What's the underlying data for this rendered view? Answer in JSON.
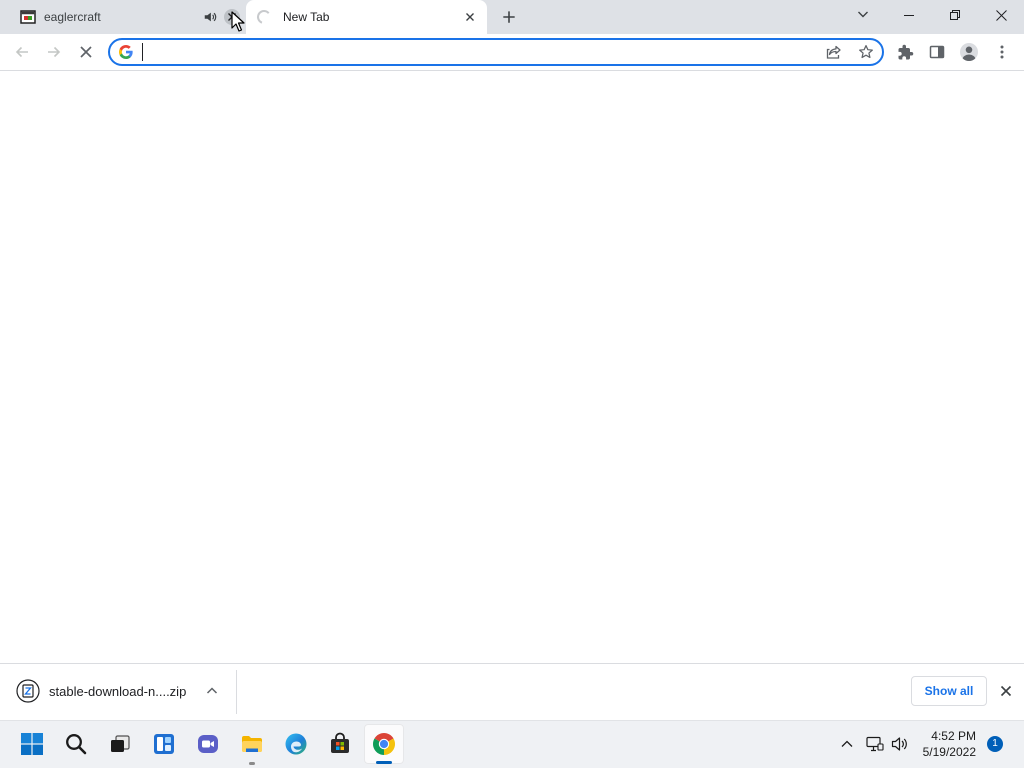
{
  "window": {
    "tabs": [
      {
        "title": "eaglercraft",
        "favicon": "eaglercraft-favicon-icon",
        "audio_icon": "speaker-icon",
        "close_icon": "close-icon",
        "close_hovered": true,
        "active": false
      },
      {
        "title": "New Tab",
        "favicon": "loading-spinner-icon",
        "close_icon": "close-icon",
        "active": true
      }
    ],
    "new_tab_icon": "plus-icon",
    "tab_search_icon": "chevron-down-icon",
    "window_controls": [
      "minimize-icon",
      "restore-icon",
      "close-icon"
    ]
  },
  "toolbar": {
    "navigation": [
      "back-arrow-icon",
      "forward-arrow-icon",
      "stop-loading-icon"
    ],
    "omnibox": {
      "value": "",
      "engine_icon": "google-g-icon",
      "actions": [
        "share-icon",
        "bookmark-star-icon"
      ]
    },
    "actions": [
      "extensions-puzzle-icon",
      "side-panel-icon",
      "profile-avatar-icon",
      "menu-kebab-icon"
    ]
  },
  "download_shelf": {
    "items": [
      {
        "filename": "stable-download-n....zip",
        "icon": "zip-file-icon",
        "menu_icon": "chevron-up-icon"
      }
    ],
    "show_all_label": "Show all",
    "close_icon": "close-icon"
  },
  "taskbar": {
    "pinned": [
      "start-windows-icon",
      "search-icon",
      "task-view-icon",
      "widgets-icon",
      "teams-chat-icon",
      "file-explorer-icon",
      "edge-icon",
      "store-icon",
      "chrome-icon"
    ],
    "running": [
      "file-explorer-icon",
      "chrome-icon"
    ],
    "active_app": "chrome-icon",
    "tray": {
      "overflow_icon": "chevron-up-icon",
      "network_icon": "network-icon",
      "volume_icon": "volume-icon",
      "time": "4:52 PM",
      "date": "5/19/2022",
      "notification_count": "1"
    }
  },
  "colors": {
    "accent": "#1a73e8",
    "tab_strip": "#dee1e6",
    "taskbar": "#eff1f4",
    "taskbar_active_indicator": "#005fb8"
  }
}
